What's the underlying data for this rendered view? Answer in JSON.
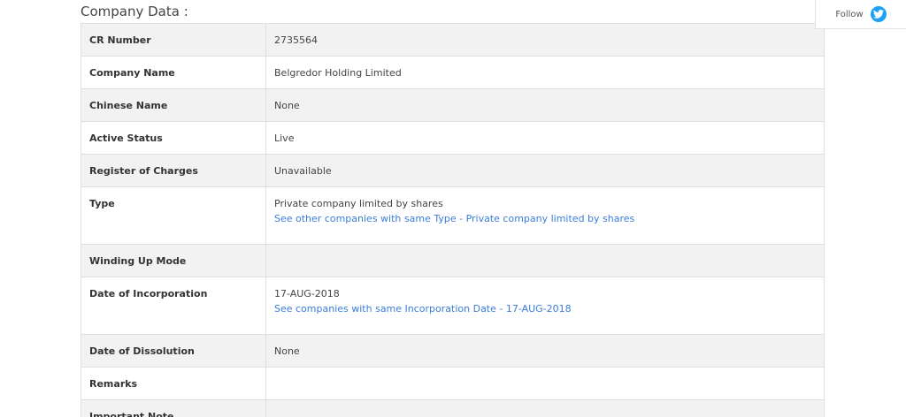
{
  "section": {
    "title": "Company Data :"
  },
  "follow": {
    "label": "Follow",
    "icon": "twitter-icon",
    "icon_color": "#1da1f2"
  },
  "rows": [
    {
      "label": "CR Number",
      "value": "2735564"
    },
    {
      "label": "Company Name",
      "value": "Belgredor Holding Limited"
    },
    {
      "label": "Chinese Name",
      "value": "None"
    },
    {
      "label": "Active Status",
      "value": "Live"
    },
    {
      "label": "Register of Charges",
      "value": "Unavailable"
    },
    {
      "label": "Type",
      "value": "Private company limited by shares",
      "link": "See other companies with same Type - Private company limited by shares"
    },
    {
      "label": "Winding Up Mode",
      "value": ""
    },
    {
      "label": "Date of Incorporation",
      "value": "17-AUG-2018",
      "link": "See companies with same Incorporation Date - 17-AUG-2018"
    },
    {
      "label": "Date of Dissolution",
      "value": "None"
    },
    {
      "label": "Remarks",
      "value": ""
    },
    {
      "label": "Important Note",
      "value": ""
    }
  ],
  "colors": {
    "link": "#3b7ddd",
    "row_shade": "#f2f2f2",
    "border": "#dedede"
  }
}
